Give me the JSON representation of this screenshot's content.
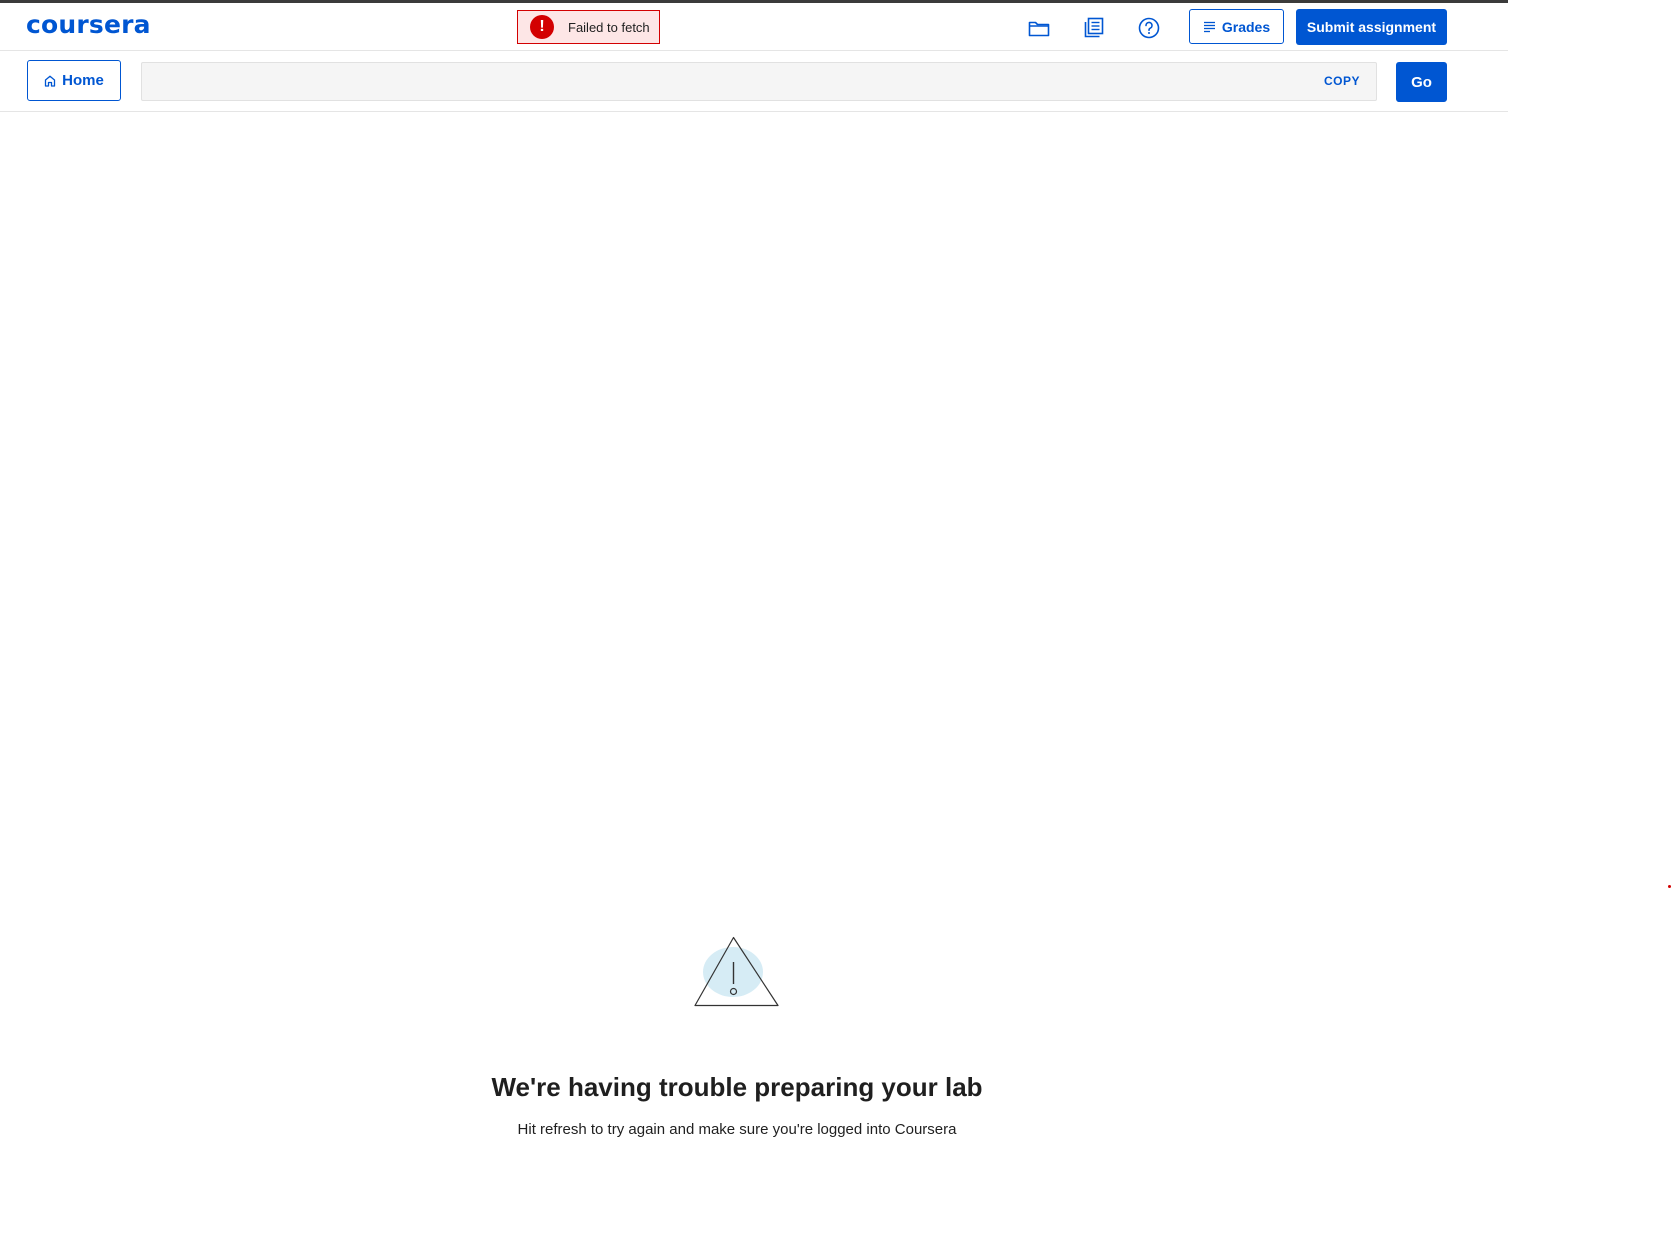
{
  "header": {
    "logo": "coursera",
    "toast": {
      "text": "Failed to fetch",
      "icon": "error-icon"
    },
    "icons": [
      "folder-icon",
      "notebook-icon",
      "help-icon"
    ],
    "grades_label": "Grades",
    "submit_label": "Submit assignment"
  },
  "toolbar": {
    "home_label": "Home",
    "url_value": "",
    "copy_label": "COPY",
    "go_label": "Go"
  },
  "main": {
    "error_title": "We're having trouble preparing your lab",
    "error_subtitle": "Hit refresh to try again and make sure you're logged into Coursera"
  },
  "colors": {
    "brand": "#0056d2",
    "error": "#d30001",
    "error_bg": "#fde6e6",
    "illustration_fill": "#d6ecf5"
  }
}
